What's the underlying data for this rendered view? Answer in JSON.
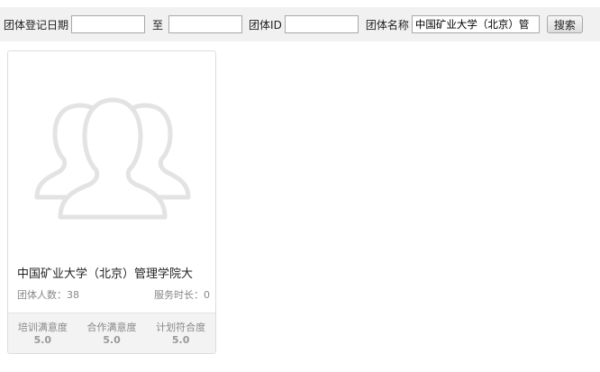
{
  "filters": {
    "reg_date_label": "团体登记日期",
    "reg_date_from": "",
    "to_label": "至",
    "reg_date_to": "",
    "group_id_label": "团体ID",
    "group_id_value": "",
    "group_name_label": "团体名称",
    "group_name_value": "中国矿业大学（北京）管",
    "search_label": "搜索"
  },
  "card": {
    "title": "中国矿业大学（北京）管理学院大",
    "member_count_label": "团体人数：",
    "member_count": "38",
    "service_hours_label": "服务时长：",
    "service_hours": "0",
    "avatar_icon": "group-avatar-icon",
    "stats": [
      {
        "label": "培训满意度",
        "value": "5.0"
      },
      {
        "label": "合作满意度",
        "value": "5.0"
      },
      {
        "label": "计划符合度",
        "value": "5.0"
      }
    ]
  }
}
